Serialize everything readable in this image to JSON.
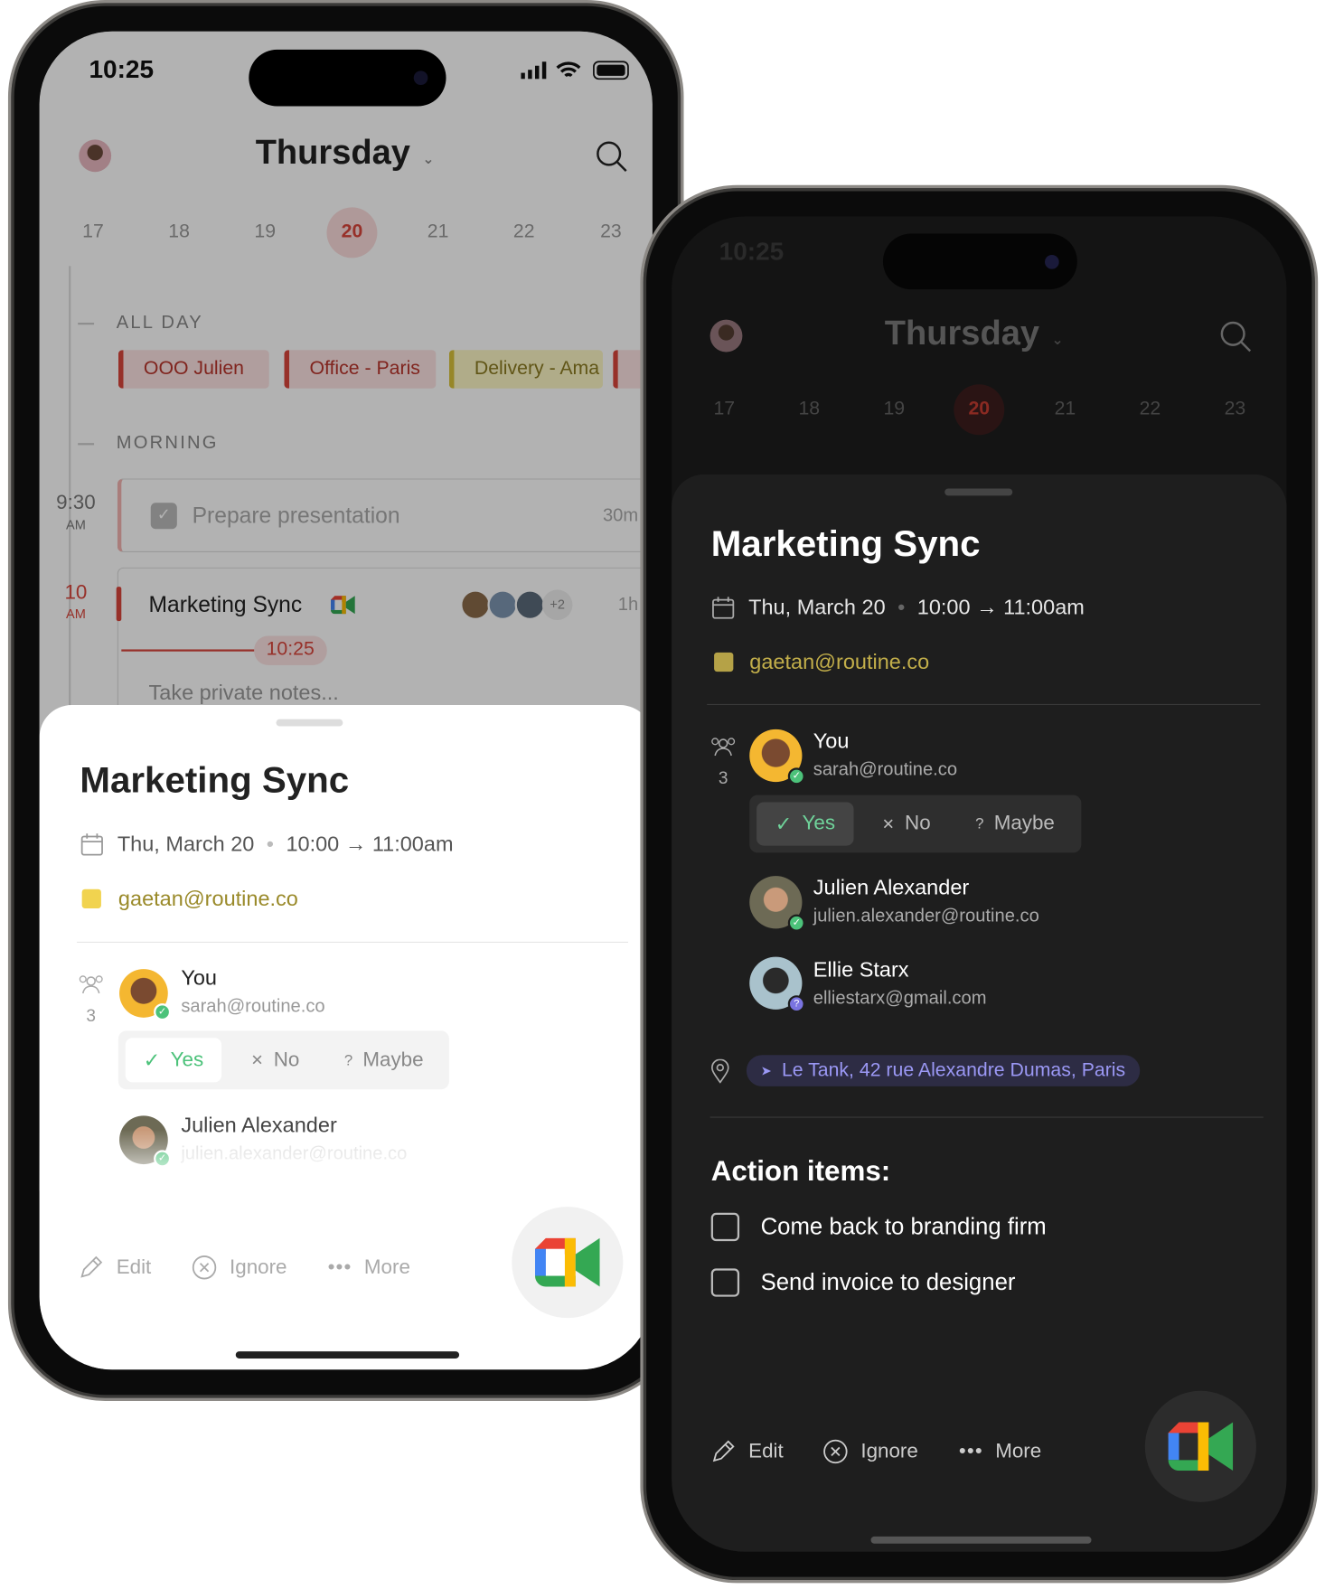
{
  "status": {
    "time": "10:25"
  },
  "header": {
    "day": "Thursday"
  },
  "week": {
    "days": [
      "17",
      "18",
      "19",
      "20",
      "21",
      "22",
      "23"
    ],
    "selected": "20"
  },
  "calendar": {
    "all_day_label": "ALL DAY",
    "all_day_events": [
      {
        "label": "OOO Julien",
        "color": "#d9453b"
      },
      {
        "label": "Office - Paris",
        "color": "#d9453b"
      },
      {
        "label": "Delivery - Ama",
        "color": "#d8c23a"
      }
    ],
    "morning_label": "MORNING",
    "events": [
      {
        "time": "9:30",
        "ampm": "AM",
        "title": "Prepare presentation",
        "duration": "30m",
        "done": true
      },
      {
        "time": "10",
        "ampm": "AM",
        "title": "Marketing Sync",
        "duration": "1h",
        "extra_attendees": "+2",
        "notes_placeholder": "Take private notes..."
      }
    ],
    "now": "10:25"
  },
  "event": {
    "title": "Marketing Sync",
    "date": "Thu, March 20",
    "time_range": "10:00 → 11:00am",
    "calendar_account": "gaetan@routine.co",
    "calendar_color": "#e9c93f",
    "attendee_count": "3",
    "attendees": [
      {
        "name": "You",
        "email": "sarah@routine.co",
        "status": "accepted"
      },
      {
        "name": "Julien Alexander",
        "email": "julien.alexander@routine.co",
        "status": "accepted"
      },
      {
        "name": "Ellie Starx",
        "email": "elliestarx@gmail.com",
        "status": "maybe"
      }
    ],
    "rsvp": {
      "yes": "Yes",
      "no": "No",
      "maybe": "Maybe",
      "selected": "yes"
    },
    "location": "Le Tank, 42 rue Alexandre Dumas, Paris",
    "action_items_title": "Action items:",
    "action_items": [
      {
        "label": "Come back to branding firm",
        "checked": false
      },
      {
        "label": "Send invoice to designer",
        "checked": false
      }
    ]
  },
  "actions": {
    "edit": "Edit",
    "ignore": "Ignore",
    "more": "More"
  },
  "colors": {
    "accent_red": "#d9453b",
    "yes_green": "#4cc27a",
    "location_purple": "#8f8cf0"
  }
}
